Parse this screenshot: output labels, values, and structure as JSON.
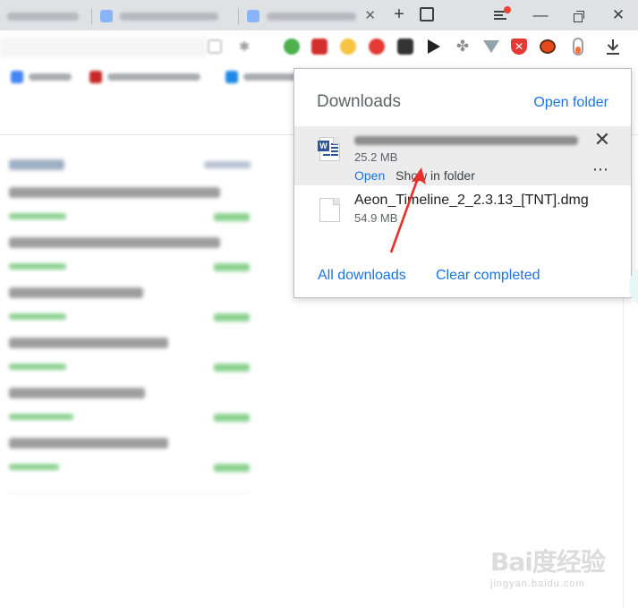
{
  "colors": {
    "tab_strip": "#dfe1e5",
    "link_blue": "#1a73e8",
    "highlight_row": "#ececec",
    "annotation_red": "#e8302a",
    "blurred_green": "#8bd18f"
  },
  "window": {
    "tab_icons": [
      "page-icon",
      "page-icon",
      "page-icon"
    ],
    "new_tab_icon": "plus",
    "controls": [
      "menu-icon",
      "minimize-icon",
      "restore-icon",
      "close-icon"
    ]
  },
  "toolbar": {
    "extension_icons": [
      "wechat-extension-icon",
      "red-download-extension-icon",
      "lightbulb-extension-icon",
      "red-circle-extension-icon",
      "dark-extension-icon",
      "puzzle-extension-icon",
      "arrow-extension-icon",
      "shield-extension-icon",
      "ladybug-extension-icon",
      "toggle-extension-icon"
    ],
    "download_icon": "download-arrow"
  },
  "downloads": {
    "title": "Downloads",
    "open_folder": "Open folder",
    "items": [
      {
        "icon": "word-doc-icon",
        "name_blurred": true,
        "size": "25.2 MB",
        "open_label": "Open",
        "show_label": "Show in folder",
        "more_label": "⋯",
        "close_label": "✕"
      },
      {
        "icon": "generic-file-icon",
        "name": "Aeon_Timeline_2_2.3.13_[TNT].dmg",
        "size": "54.9 MB"
      }
    ],
    "all_downloads": "All downloads",
    "clear_completed": "Clear completed"
  },
  "watermark": {
    "text": "Bai度经验",
    "url": "jingyan.baidu.com"
  }
}
